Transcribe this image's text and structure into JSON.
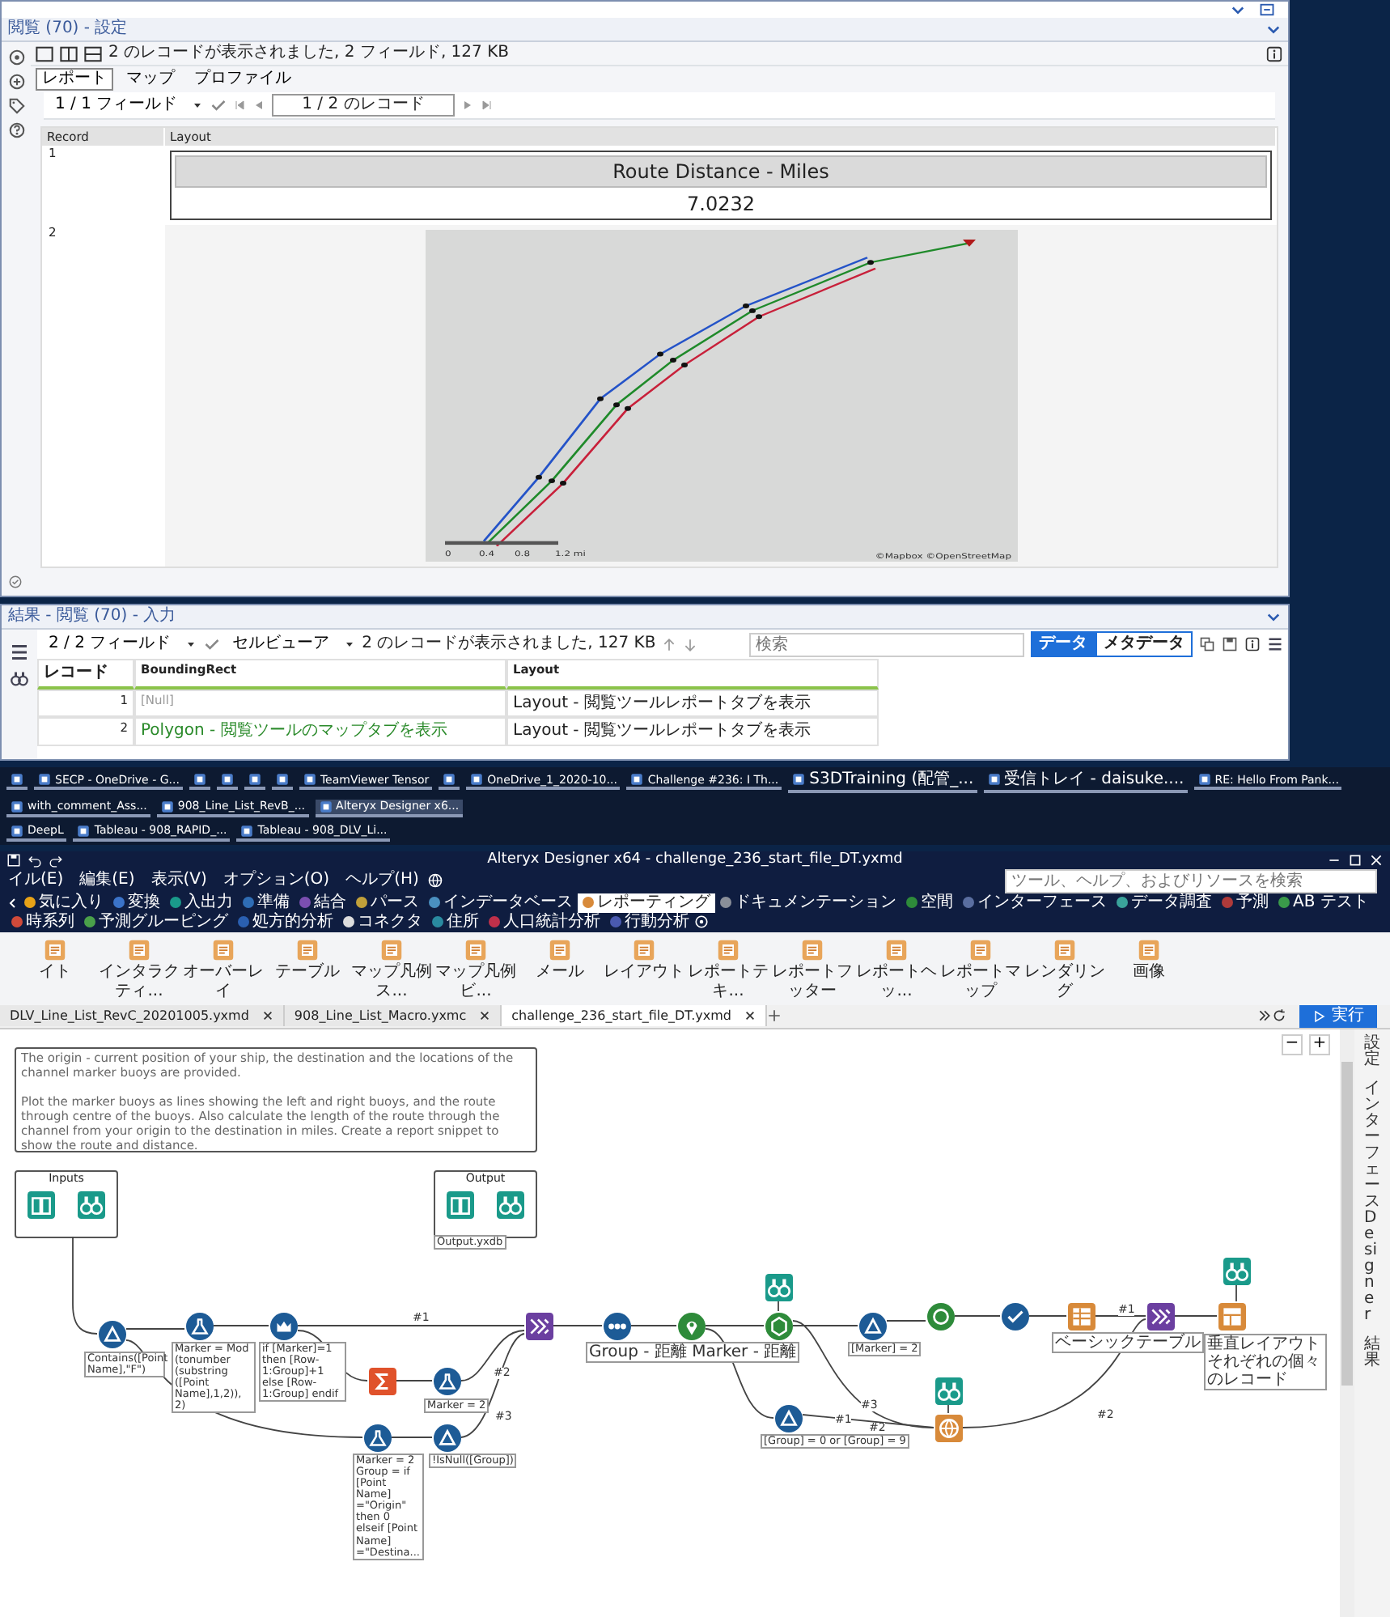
{
  "browse_window": {
    "header": "閲覧 (70) - 設定",
    "status": "2 のレコードが表示されました, 2 フィールド, 127 KB",
    "tabs": [
      {
        "label": "レポート",
        "selected": true
      },
      {
        "label": "マップ",
        "selected": false
      },
      {
        "label": "プロファイル",
        "selected": false
      }
    ],
    "field_selector": "1 / 1 フィールド",
    "record_nav": "1 / 2 のレコード",
    "columns": [
      "Record",
      "Layout"
    ],
    "rows": [
      {
        "record": "1",
        "kind": "report",
        "title": "Route Distance - Miles",
        "value": "7.0232"
      },
      {
        "record": "2",
        "kind": "map",
        "scale": [
          "0",
          "0.4",
          "0.8",
          "1.2 mi"
        ],
        "attribution": "©Mapbox ©OpenStreetMap"
      }
    ]
  },
  "results_panel": {
    "header": "結果 - 閲覧 (70) - 入力",
    "field_selector": "2 / 2 フィールド",
    "viewer": "セルビューア",
    "status": "2 のレコードが表示されました, 127 KB",
    "search": {
      "placeholder": "検索"
    },
    "view_tabs": [
      {
        "label": "データ",
        "selected": true
      },
      {
        "label": "メタデータ",
        "selected": false
      }
    ],
    "columns": [
      "レコード",
      "BoundingRect",
      "Layout"
    ],
    "rows": [
      {
        "record": "1",
        "bounding_rect": "[Null]",
        "is_null": true,
        "layout": "Layout - 閲覧ツールレポートタブを表示"
      },
      {
        "record": "2",
        "bounding_rect": "Polygon - 閲覧ツールのマップタブを表示",
        "is_null": false,
        "layout": "Layout - 閲覧ツールレポートタブを表示"
      }
    ]
  },
  "taskbar": {
    "rows": [
      [
        {
          "kind": "icon",
          "selected": false
        },
        {
          "kind": "app",
          "label": "SECP - OneDrive - G...",
          "selected": false
        },
        {
          "kind": "icon",
          "selected": false
        },
        {
          "kind": "icon",
          "selected": false
        },
        {
          "kind": "icon",
          "selected": false
        },
        {
          "kind": "icon",
          "selected": false
        },
        {
          "kind": "app",
          "label": "TeamViewer Tensor",
          "selected": false
        },
        {
          "kind": "icon",
          "selected": false
        },
        {
          "kind": "app",
          "label": "OneDrive_1_2020-10...",
          "selected": false
        },
        {
          "kind": "app",
          "label": "Challenge #236: I Th...",
          "selected": false
        },
        {
          "kind": "app",
          "label": "S3DTraining (配管_...",
          "selected": false
        },
        {
          "kind": "app",
          "label": "受信トレイ - daisuke....",
          "selected": false
        },
        {
          "kind": "app",
          "label": "RE: Hello From Pank...",
          "selected": false
        },
        {
          "kind": "app",
          "label": "with_comment_Ass...",
          "selected": false
        },
        {
          "kind": "app",
          "label": "908_Line_List_RevB_...",
          "selected": false
        },
        {
          "kind": "app",
          "label": "Alteryx Designer x6...",
          "selected": true
        }
      ],
      [
        {
          "kind": "app",
          "label": "DeepL",
          "selected": false
        },
        {
          "kind": "app",
          "label": "Tableau - 908_RAPID_...",
          "selected": false
        },
        {
          "kind": "app",
          "label": "Tableau - 908_DLV_Li...",
          "selected": false
        }
      ]
    ]
  },
  "designer": {
    "title": "Alteryx Designer x64 - challenge_236_start_file_DT.yxmd",
    "menu": [
      "イル(E)",
      "編集(E)",
      "表示(V)",
      "オプション(O)",
      "ヘルプ(H)"
    ],
    "search": {
      "placeholder": "ツール、ヘルプ、およびリソースを検索"
    },
    "categories": [
      {
        "label": "気に入り",
        "selected": false,
        "color": "#e8a317"
      },
      {
        "label": "変換",
        "selected": false,
        "color": "#3b73c8"
      },
      {
        "label": "入出力",
        "selected": false,
        "color": "#1a9a8a"
      },
      {
        "label": "準備",
        "selected": false,
        "color": "#2f6db5"
      },
      {
        "label": "結合",
        "selected": false,
        "color": "#7b4fb0"
      },
      {
        "label": "パース",
        "selected": false,
        "color": "#c2a13a"
      },
      {
        "label": "インデータベース",
        "selected": false,
        "color": "#4a90c0"
      },
      {
        "label": "レポーティング",
        "selected": true,
        "color": "#d88a3a"
      },
      {
        "label": "ドキュメンテーション",
        "selected": false,
        "color": "#8a8f99"
      },
      {
        "label": "空間",
        "selected": false,
        "color": "#2e8b3a"
      },
      {
        "label": "インターフェース",
        "selected": false,
        "color": "#5a6ea0"
      },
      {
        "label": "データ調査",
        "selected": false,
        "color": "#3aa39b"
      },
      {
        "label": "予測",
        "selected": false,
        "color": "#b03a3a"
      },
      {
        "label": "AB テスト",
        "selected": false,
        "color": "#3a9a4a"
      },
      {
        "label": "時系列",
        "selected": false,
        "color": "#d04a3a"
      },
      {
        "label": "予測グルーピング",
        "selected": false,
        "color": "#4aa04a"
      },
      {
        "label": "処方的分析",
        "selected": false,
        "color": "#2a5fb0"
      },
      {
        "label": "コネクタ",
        "selected": false,
        "color": "#dddddd"
      },
      {
        "label": "住所",
        "selected": false,
        "color": "#2a8aa0"
      },
      {
        "label": "人口統計分析",
        "selected": false,
        "color": "#c0304a"
      },
      {
        "label": "行動分析",
        "selected": false,
        "color": "#4a5ab0"
      }
    ],
    "tools": [
      "イト",
      "インタラクティ...",
      "オーバーレイ",
      "テーブル",
      "マップ凡例ス...",
      "マップ凡例ビ...",
      "メール",
      "レイアウト",
      "レポートテキ...",
      "レポートフッター",
      "レポートヘッ...",
      "レポートマップ",
      "レンダリング",
      "画像"
    ],
    "doc_tabs": [
      {
        "label": "DLV_Line_List_RevC_20201005.yxmd",
        "selected": false
      },
      {
        "label": "908_Line_List_Macro.yxmc",
        "selected": false
      },
      {
        "label": "challenge_236_start_file_DT.yxmd",
        "selected": true
      }
    ],
    "run_button": "実行",
    "side_panel": [
      "設定",
      "インターフェース Designer",
      "結果"
    ],
    "zoom_buttons": [
      "−",
      "+"
    ],
    "comment": [
      "The origin - current position of your ship, the destination and the locations of the channel marker buoys are provided.",
      "Plot the marker buoys as lines showing the left and right buoys, and the route through centre of the buoys. Also calculate the length of the route through the channel from your origin to the destination in miles. Create a report snippet to show the route and distance."
    ],
    "containers": [
      {
        "title": "Inputs",
        "tools": [
          {
            "kind": "input"
          },
          {
            "kind": "browse"
          }
        ]
      },
      {
        "title": "Output",
        "tools": [
          {
            "kind": "output"
          },
          {
            "kind": "browse"
          }
        ],
        "annotation": "Output.yxdb"
      }
    ],
    "nodes": [
      {
        "kind": "filter",
        "annotation": "Contains([Point Name],\"F\")"
      },
      {
        "kind": "formula",
        "annotation": "Marker = Mod (tonumber (substring ([Point Name],1,2)), 2)"
      },
      {
        "kind": "multirow",
        "annotation": "if [Marker]=1 then [Row-1:Group]+1 else [Row-1:Group] endif"
      },
      {
        "kind": "summarize"
      },
      {
        "kind": "formula",
        "annotation": "Marker = 2"
      },
      {
        "kind": "formula",
        "annotation": "Marker = 2 Group = if [Point Name] =\"Origin\" then 0 elseif [Point Name] =\"Destina..."
      },
      {
        "kind": "filter",
        "annotation": "!IsNull([Group])"
      },
      {
        "kind": "union"
      },
      {
        "kind": "polybuild",
        "annotation": "Group - 距離 Marker - 距離"
      },
      {
        "kind": "spatial"
      },
      {
        "kind": "browse"
      },
      {
        "kind": "spatialmatch"
      },
      {
        "kind": "filter",
        "annotation": "[Marker] = 2"
      },
      {
        "kind": "test"
      },
      {
        "kind": "check"
      },
      {
        "kind": "table",
        "annotation": "ベーシックテーブル"
      },
      {
        "kind": "union"
      },
      {
        "kind": "browse"
      },
      {
        "kind": "layout",
        "annotation": "垂直レイアウトそれぞれの個々のレコード"
      },
      {
        "kind": "filter",
        "annotation": "[Group] = 0 or [Group] = 9"
      },
      {
        "kind": "browse"
      },
      {
        "kind": "globe"
      }
    ],
    "connection_labels": [
      "#1",
      "#2",
      "#3",
      "#3",
      "#1",
      "#2",
      "#1",
      "#2"
    ]
  }
}
